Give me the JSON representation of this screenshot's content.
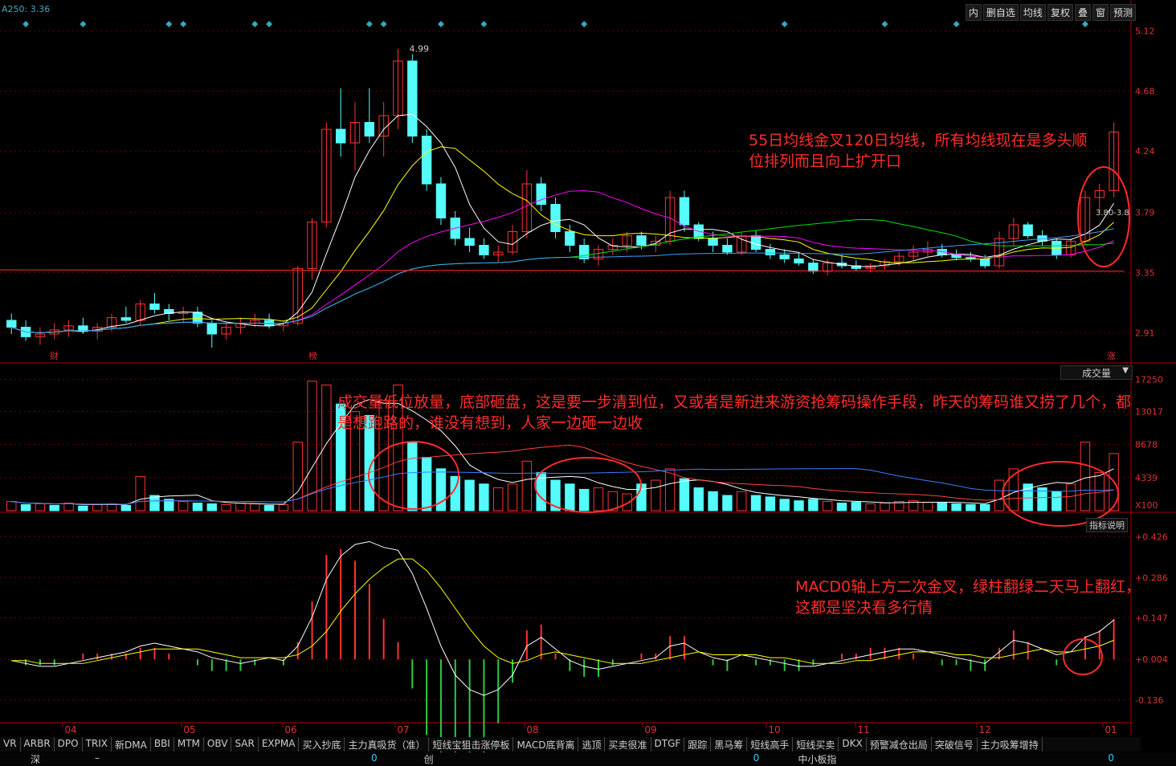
{
  "header": {
    "ma_readout": "A250: 3.36",
    "toolbar": [
      "内",
      "删自选",
      "均线",
      "复权",
      "叠",
      "窗",
      "预测"
    ]
  },
  "price_axis": {
    "ticks": [
      "5.12",
      "4.68",
      "4.24",
      "3.79",
      "3.35",
      "2.91"
    ]
  },
  "volume_axis": {
    "select": "成交量",
    "ticks": [
      "17250",
      "13017",
      "8678",
      "4339"
    ],
    "unit": "X100"
  },
  "macd_axis": {
    "ticks": [
      "+0.426",
      "+0.286",
      "+0.147",
      "+0.004",
      "-0.136"
    ]
  },
  "x_axis": {
    "labels": [
      "04",
      "05",
      "06",
      "07",
      "08",
      "09",
      "10",
      "11",
      "12",
      "01"
    ]
  },
  "price_marks": {
    "high_label": "4.99",
    "range_label": "3.80-3.8",
    "event_labels": [
      "财",
      "榜",
      "涨"
    ]
  },
  "annotations": {
    "price": "55日均线金叉120日均线，所有均线现在是多头顺位排列而且向上扩开口",
    "volume": "成交量低位放量，底部砸盘，这是要一步清到位，又或者是新进来游资抢筹码操作手段，昨天的筹码谁又捞了几个，都是想跑路的，谁没有想到，人家一边砸一边收",
    "macd": "MACD0轴上方二次金叉，绿柱翻绿二天马上翻红，这都是坚决看多行情"
  },
  "indicator_buttons": [
    "指标说明"
  ],
  "tabs": [
    "VR",
    "ARBR",
    "DPO",
    "TRIX",
    "新DMA",
    "BBI",
    "MTM",
    "OBV",
    "SAR",
    "EXPMA",
    "买入抄底",
    "主力真吸货（准）",
    "短线宝狙击涨停板",
    "MACD底背离",
    "逃顶",
    "买卖很准",
    "DTGF",
    "跟踪",
    "黑马筹",
    "短线高手",
    "短线买卖",
    "DKX",
    "预警减仓出局",
    "突破信号",
    "主力吸筹增持"
  ],
  "status_bar": {
    "left_name": "深",
    "left_val": "–",
    "left_num": "0",
    "mid_name": "创",
    "mid_num": "0",
    "right_name": "中小板指",
    "right_num": "0"
  },
  "colors": {
    "up": "#ff3232",
    "down": "#54fcfc",
    "annotation": "#ff2b2b",
    "ma5": "#ffffff",
    "ma10": "#ffff00",
    "ma20": "#ff00ff",
    "ma55": "#00e000",
    "ma120": "#3ca0ff",
    "ma250": "#ff3030"
  },
  "chart_data": {
    "type": "candlestick",
    "y_price_range": [
      2.7,
      5.2
    ],
    "candles": [
      [
        3.0,
        3.05,
        2.9,
        2.95
      ],
      [
        2.95,
        3.0,
        2.85,
        2.88
      ],
      [
        2.88,
        2.95,
        2.82,
        2.9
      ],
      [
        2.9,
        2.98,
        2.86,
        2.93
      ],
      [
        2.93,
        3.0,
        2.88,
        2.96
      ],
      [
        2.96,
        3.02,
        2.9,
        2.92
      ],
      [
        2.92,
        2.98,
        2.86,
        2.95
      ],
      [
        2.95,
        3.05,
        2.92,
        3.02
      ],
      [
        3.02,
        3.1,
        2.98,
        3.0
      ],
      [
        3.0,
        3.15,
        2.96,
        3.12
      ],
      [
        3.12,
        3.2,
        3.05,
        3.08
      ],
      [
        3.08,
        3.12,
        3.0,
        3.05
      ],
      [
        3.05,
        3.1,
        2.98,
        3.06
      ],
      [
        3.06,
        3.1,
        2.95,
        2.98
      ],
      [
        2.98,
        3.0,
        2.8,
        2.9
      ],
      [
        2.9,
        2.98,
        2.86,
        2.95
      ],
      [
        2.95,
        3.02,
        2.9,
        2.98
      ],
      [
        2.98,
        3.05,
        2.95,
        3.0
      ],
      [
        3.0,
        3.05,
        2.94,
        2.96
      ],
      [
        2.96,
        3.0,
        2.92,
        2.98
      ],
      [
        2.98,
        3.4,
        2.96,
        3.38
      ],
      [
        3.38,
        3.75,
        3.3,
        3.72
      ],
      [
        3.72,
        4.45,
        3.68,
        4.4
      ],
      [
        4.4,
        4.7,
        4.2,
        4.3
      ],
      [
        4.3,
        4.6,
        4.1,
        4.45
      ],
      [
        4.45,
        4.7,
        4.3,
        4.35
      ],
      [
        4.35,
        4.6,
        4.2,
        4.5
      ],
      [
        4.5,
        4.99,
        4.4,
        4.9
      ],
      [
        4.9,
        4.95,
        4.3,
        4.35
      ],
      [
        4.35,
        4.4,
        3.95,
        4.0
      ],
      [
        4.0,
        4.05,
        3.7,
        3.75
      ],
      [
        3.75,
        3.8,
        3.55,
        3.6
      ],
      [
        3.6,
        3.68,
        3.5,
        3.55
      ],
      [
        3.55,
        3.6,
        3.45,
        3.48
      ],
      [
        3.48,
        3.55,
        3.42,
        3.5
      ],
      [
        3.5,
        3.7,
        3.48,
        3.65
      ],
      [
        3.65,
        4.1,
        3.6,
        4.0
      ],
      [
        4.0,
        4.05,
        3.8,
        3.85
      ],
      [
        3.85,
        3.9,
        3.6,
        3.65
      ],
      [
        3.65,
        3.7,
        3.5,
        3.55
      ],
      [
        3.55,
        3.6,
        3.42,
        3.45
      ],
      [
        3.45,
        3.55,
        3.4,
        3.52
      ],
      [
        3.52,
        3.6,
        3.48,
        3.55
      ],
      [
        3.55,
        3.65,
        3.5,
        3.62
      ],
      [
        3.62,
        3.65,
        3.52,
        3.55
      ],
      [
        3.55,
        3.62,
        3.5,
        3.58
      ],
      [
        3.58,
        3.95,
        3.55,
        3.9
      ],
      [
        3.9,
        3.95,
        3.65,
        3.7
      ],
      [
        3.7,
        3.72,
        3.58,
        3.6
      ],
      [
        3.6,
        3.65,
        3.5,
        3.55
      ],
      [
        3.55,
        3.6,
        3.48,
        3.5
      ],
      [
        3.5,
        3.65,
        3.48,
        3.62
      ],
      [
        3.62,
        3.66,
        3.5,
        3.52
      ],
      [
        3.52,
        3.56,
        3.45,
        3.48
      ],
      [
        3.48,
        3.52,
        3.42,
        3.45
      ],
      [
        3.45,
        3.5,
        3.4,
        3.42
      ],
      [
        3.42,
        3.45,
        3.34,
        3.36
      ],
      [
        3.36,
        3.45,
        3.33,
        3.42
      ],
      [
        3.42,
        3.48,
        3.38,
        3.4
      ],
      [
        3.4,
        3.44,
        3.36,
        3.38
      ],
      [
        3.38,
        3.42,
        3.35,
        3.4
      ],
      [
        3.4,
        3.45,
        3.37,
        3.43
      ],
      [
        3.43,
        3.5,
        3.4,
        3.47
      ],
      [
        3.47,
        3.55,
        3.44,
        3.5
      ],
      [
        3.5,
        3.58,
        3.47,
        3.52
      ],
      [
        3.52,
        3.56,
        3.46,
        3.48
      ],
      [
        3.48,
        3.52,
        3.44,
        3.46
      ],
      [
        3.46,
        3.5,
        3.43,
        3.45
      ],
      [
        3.45,
        3.48,
        3.38,
        3.4
      ],
      [
        3.4,
        3.65,
        3.38,
        3.6
      ],
      [
        3.6,
        3.75,
        3.55,
        3.7
      ],
      [
        3.7,
        3.72,
        3.6,
        3.62
      ],
      [
        3.62,
        3.66,
        3.55,
        3.58
      ],
      [
        3.58,
        3.6,
        3.45,
        3.48
      ],
      [
        3.48,
        3.6,
        3.46,
        3.58
      ],
      [
        3.58,
        3.95,
        3.55,
        3.9
      ],
      [
        3.9,
        4.0,
        3.8,
        3.95
      ],
      [
        3.95,
        4.45,
        3.9,
        4.38
      ]
    ],
    "volume": [
      1.2,
      0.8,
      0.9,
      0.7,
      1.0,
      0.6,
      0.8,
      0.9,
      0.7,
      4.5,
      2.0,
      1.5,
      1.2,
      1.0,
      0.9,
      0.8,
      1.0,
      0.9,
      0.7,
      0.8,
      9.0,
      17.0,
      16.5,
      14.0,
      13.0,
      12.5,
      14.5,
      16.5,
      9.0,
      7.0,
      5.5,
      4.5,
      4.0,
      3.5,
      3.0,
      3.5,
      6.5,
      5.0,
      4.0,
      3.5,
      2.8,
      3.0,
      2.5,
      2.2,
      3.5,
      4.0,
      5.5,
      4.2,
      3.0,
      2.5,
      2.0,
      2.5,
      2.0,
      1.8,
      1.5,
      1.3,
      1.5,
      1.2,
      1.0,
      1.1,
      0.9,
      1.0,
      1.2,
      1.3,
      1.1,
      1.0,
      0.9,
      0.8,
      0.8,
      4.0,
      5.5,
      3.5,
      3.0,
      2.5,
      3.5,
      9.0,
      5.0,
      7.5
    ],
    "volume_up": [
      true,
      false,
      true,
      false,
      true,
      false,
      true,
      true,
      false,
      true,
      false,
      false,
      true,
      false,
      false,
      true,
      true,
      true,
      false,
      true,
      true,
      true,
      true,
      false,
      true,
      false,
      true,
      true,
      false,
      false,
      false,
      false,
      false,
      false,
      true,
      true,
      true,
      false,
      false,
      false,
      false,
      true,
      true,
      true,
      false,
      true,
      true,
      false,
      false,
      false,
      false,
      true,
      false,
      false,
      false,
      false,
      false,
      true,
      false,
      false,
      true,
      true,
      true,
      true,
      true,
      false,
      false,
      false,
      false,
      true,
      true,
      false,
      false,
      false,
      true,
      true,
      true,
      true
    ],
    "macd_diff": [
      0.0,
      -0.01,
      -0.02,
      -0.02,
      -0.01,
      0.0,
      0.01,
      0.02,
      0.03,
      0.05,
      0.06,
      0.05,
      0.04,
      0.03,
      0.01,
      0.0,
      -0.01,
      0.0,
      0.01,
      0.0,
      0.05,
      0.15,
      0.28,
      0.36,
      0.4,
      0.41,
      0.39,
      0.38,
      0.3,
      0.18,
      0.05,
      -0.05,
      -0.1,
      -0.12,
      -0.1,
      -0.05,
      0.05,
      0.08,
      0.04,
      0.0,
      -0.02,
      -0.03,
      -0.02,
      -0.01,
      0.0,
      0.01,
      0.05,
      0.06,
      0.03,
      0.01,
      0.0,
      0.02,
      0.01,
      0.0,
      -0.01,
      -0.02,
      -0.02,
      -0.01,
      0.0,
      0.01,
      0.02,
      0.03,
      0.04,
      0.04,
      0.03,
      0.02,
      0.01,
      0.0,
      -0.01,
      0.03,
      0.07,
      0.06,
      0.04,
      0.02,
      0.03,
      0.08,
      0.1,
      0.14
    ],
    "macd_dea": [
      0.0,
      0.0,
      -0.01,
      -0.01,
      -0.01,
      -0.01,
      0.0,
      0.01,
      0.02,
      0.03,
      0.04,
      0.04,
      0.04,
      0.04,
      0.03,
      0.02,
      0.01,
      0.01,
      0.01,
      0.01,
      0.02,
      0.05,
      0.1,
      0.17,
      0.23,
      0.28,
      0.32,
      0.35,
      0.35,
      0.31,
      0.25,
      0.18,
      0.11,
      0.05,
      0.01,
      -0.01,
      0.0,
      0.02,
      0.03,
      0.02,
      0.01,
      0.0,
      -0.01,
      -0.01,
      -0.01,
      0.0,
      0.01,
      0.02,
      0.03,
      0.02,
      0.02,
      0.02,
      0.02,
      0.01,
      0.01,
      0.0,
      -0.01,
      -0.01,
      -0.01,
      0.0,
      0.0,
      0.01,
      0.02,
      0.03,
      0.03,
      0.03,
      0.02,
      0.02,
      0.01,
      0.01,
      0.02,
      0.03,
      0.04,
      0.03,
      0.03,
      0.04,
      0.05,
      0.07
    ]
  }
}
